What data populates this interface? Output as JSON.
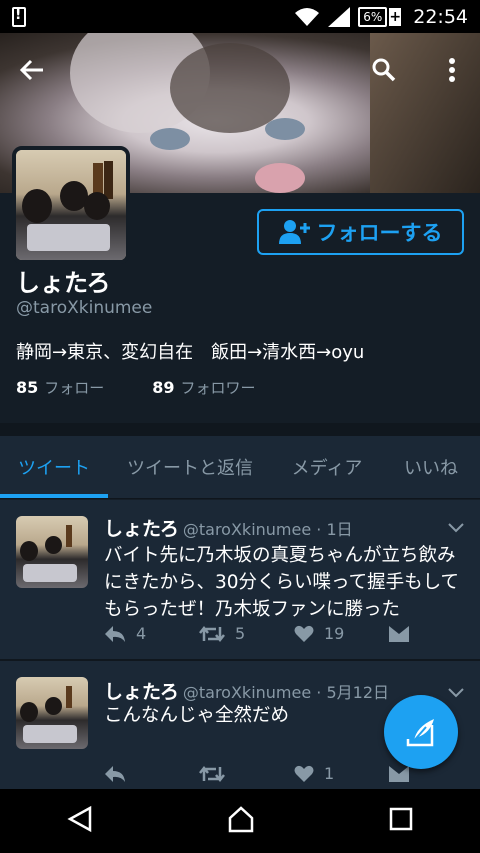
{
  "status_bar": {
    "battery": "6%",
    "time": "22:54"
  },
  "profile": {
    "name": "しょたろ",
    "handle": "@taroXkinumee",
    "bio": "静岡→東京、変幻自在　飯田→清水西→oyu",
    "following_count": "85",
    "following_label": "フォロー",
    "followers_count": "89",
    "followers_label": "フォロワー",
    "follow_button": "フォローする"
  },
  "tabs": [
    {
      "label": "ツイート",
      "active": true
    },
    {
      "label": "ツイートと返信",
      "active": false
    },
    {
      "label": "メディア",
      "active": false
    },
    {
      "label": "いいね",
      "active": false
    }
  ],
  "tweets": [
    {
      "name": "しょたろ",
      "meta": "@taroXkinumee · 1日",
      "text": "バイト先に乃木坂の真夏ちゃんが立ち飲みにきたから、30分くらい喋って握手もしてもらったぜ！乃木坂ファンに勝った",
      "replies": "4",
      "retweets": "5",
      "likes": "19"
    },
    {
      "name": "しょたろ",
      "meta": "@taroXkinumee · 5月12日",
      "text": "こんなんじゃ全然だめ",
      "replies": "",
      "retweets": "",
      "likes": "1"
    }
  ],
  "colors": {
    "accent": "#1da1f2",
    "background": "#141d26",
    "card": "#1b2836",
    "muted": "#8899a6"
  }
}
